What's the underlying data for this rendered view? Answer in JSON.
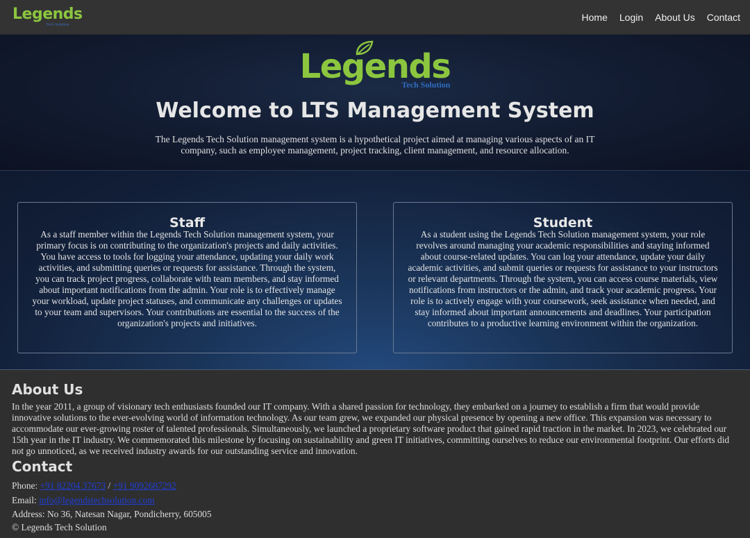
{
  "nav": {
    "logo_text": "Legends",
    "logo_sub": "Tech Solution",
    "links": [
      "Home",
      "Login",
      "About Us",
      "Contact"
    ]
  },
  "hero": {
    "logo_text": "Legends",
    "logo_sub": "Tech Solution",
    "title": "Welcome to LTS Management System",
    "description": "The Legends Tech Solution management system is a hypothetical project aimed at managing various aspects of an IT company, such as employee management, project tracking, client management, and resource allocation."
  },
  "cards": {
    "staff": {
      "title": "Staff",
      "body": "As a staff member within the Legends Tech Solution management system, your primary focus is on contributing to the organization's projects and daily activities. You have access to tools for logging your attendance, updating your daily work activities, and submitting queries or requests for assistance. Through the system, you can track project progress, collaborate with team members, and stay informed about important notifications from the admin. Your role is to effectively manage your workload, update project statuses, and communicate any challenges or updates to your team and supervisors. Your contributions are essential to the success of the organization's projects and initiatives."
    },
    "student": {
      "title": "Student",
      "body": "As a student using the Legends Tech Solution management system, your role revolves around managing your academic responsibilities and staying informed about course-related updates. You can log your attendance, update your daily academic activities, and submit queries or requests for assistance to your instructors or relevant departments. Through the system, you can access course materials, view notifications from instructors or the admin, and track your academic progress. Your role is to actively engage with your coursework, seek assistance when needed, and stay informed about important announcements and deadlines. Your participation contributes to a productive learning environment within the organization."
    }
  },
  "about": {
    "title": "About Us",
    "text": "In the year 2011, a group of visionary tech enthusiasts founded our IT company. With a shared passion for technology, they embarked on a journey to establish a firm that would provide innovative solutions to the ever-evolving world of information technology. As our team grew, we expanded our physical presence by opening a new office. This expansion was necessary to accommodate our ever-growing roster of talented professionals. Simultaneously, we launched a proprietary software product that gained rapid traction in the market. In 2023, we celebrated our 15th year in the IT industry. We commemorated this milestone by focusing on sustainability and green IT initiatives, committing ourselves to reduce our environmental footprint. Our efforts did not go unnoticed, as we received industry awards for our outstanding service and innovation."
  },
  "contact": {
    "title": "Contact",
    "phone_label": "Phone:",
    "phone1": "+91 82204 37673",
    "phone_sep": "/",
    "phone2": "+91 9092687292",
    "email_label": "Email:",
    "email": "info@legendstechsolution.com",
    "address": "Address: No 36, Natesan Nagar, Pondicherry, 605005",
    "copyright": "© Legends Tech Solution"
  },
  "colors": {
    "logo_green": "#8cc63f",
    "logo_blue": "#2f6dbf",
    "link_blue": "#1f3fd6",
    "nav_bg": "#333333",
    "page_bg": "#2f2f2f"
  }
}
